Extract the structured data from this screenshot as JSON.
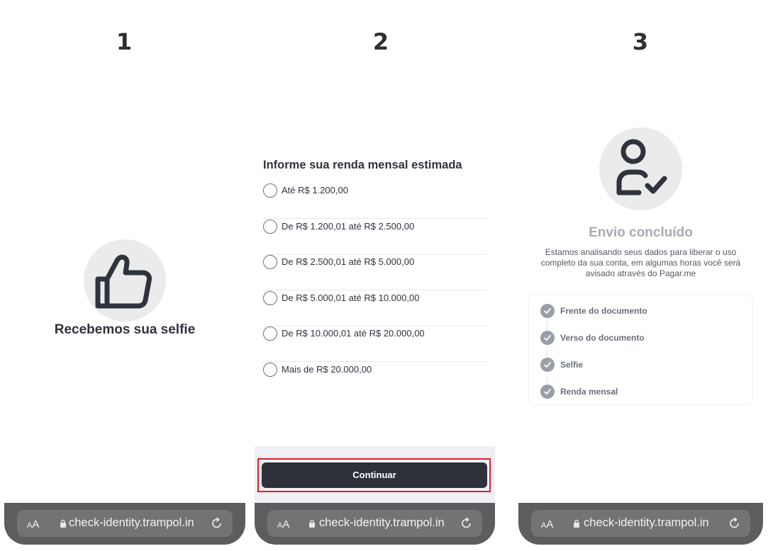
{
  "steps": [
    "1",
    "2",
    "3"
  ],
  "panel1": {
    "icon": "thumbs-up-icon",
    "title": "Recebemos sua selfie"
  },
  "panel2": {
    "question": "Informe sua renda mensal estimada",
    "options": [
      "Até R$ 1.200,00",
      "De R$ 1.200,01 até R$ 2.500,00",
      "De R$ 2.500,01 até R$ 5.000,00",
      "De R$ 5.000,01 até R$ 10.000,00",
      "De R$ 10.000,01 até R$ 20.000,00",
      "Mais de R$ 20.000,00"
    ],
    "continue_label": "Continuar"
  },
  "panel3": {
    "icon": "user-check-icon",
    "title": "Envio concluído",
    "description": "Estamos analisando seus dados para liberar o uso completo da sua conta, em algumas horas você será avisado através do Pagar.me",
    "checklist": [
      "Frente do documento",
      "Verso do documento",
      "Selfie",
      "Renda mensal"
    ]
  },
  "browser": {
    "aa_label": "AA",
    "url": "check-identity.trampol.in",
    "icons": [
      "lock-icon",
      "reload-icon"
    ]
  },
  "colors": {
    "primary_button": "#2d313a",
    "highlight": "#d9202b",
    "check_gray": "#9a9ea7"
  }
}
